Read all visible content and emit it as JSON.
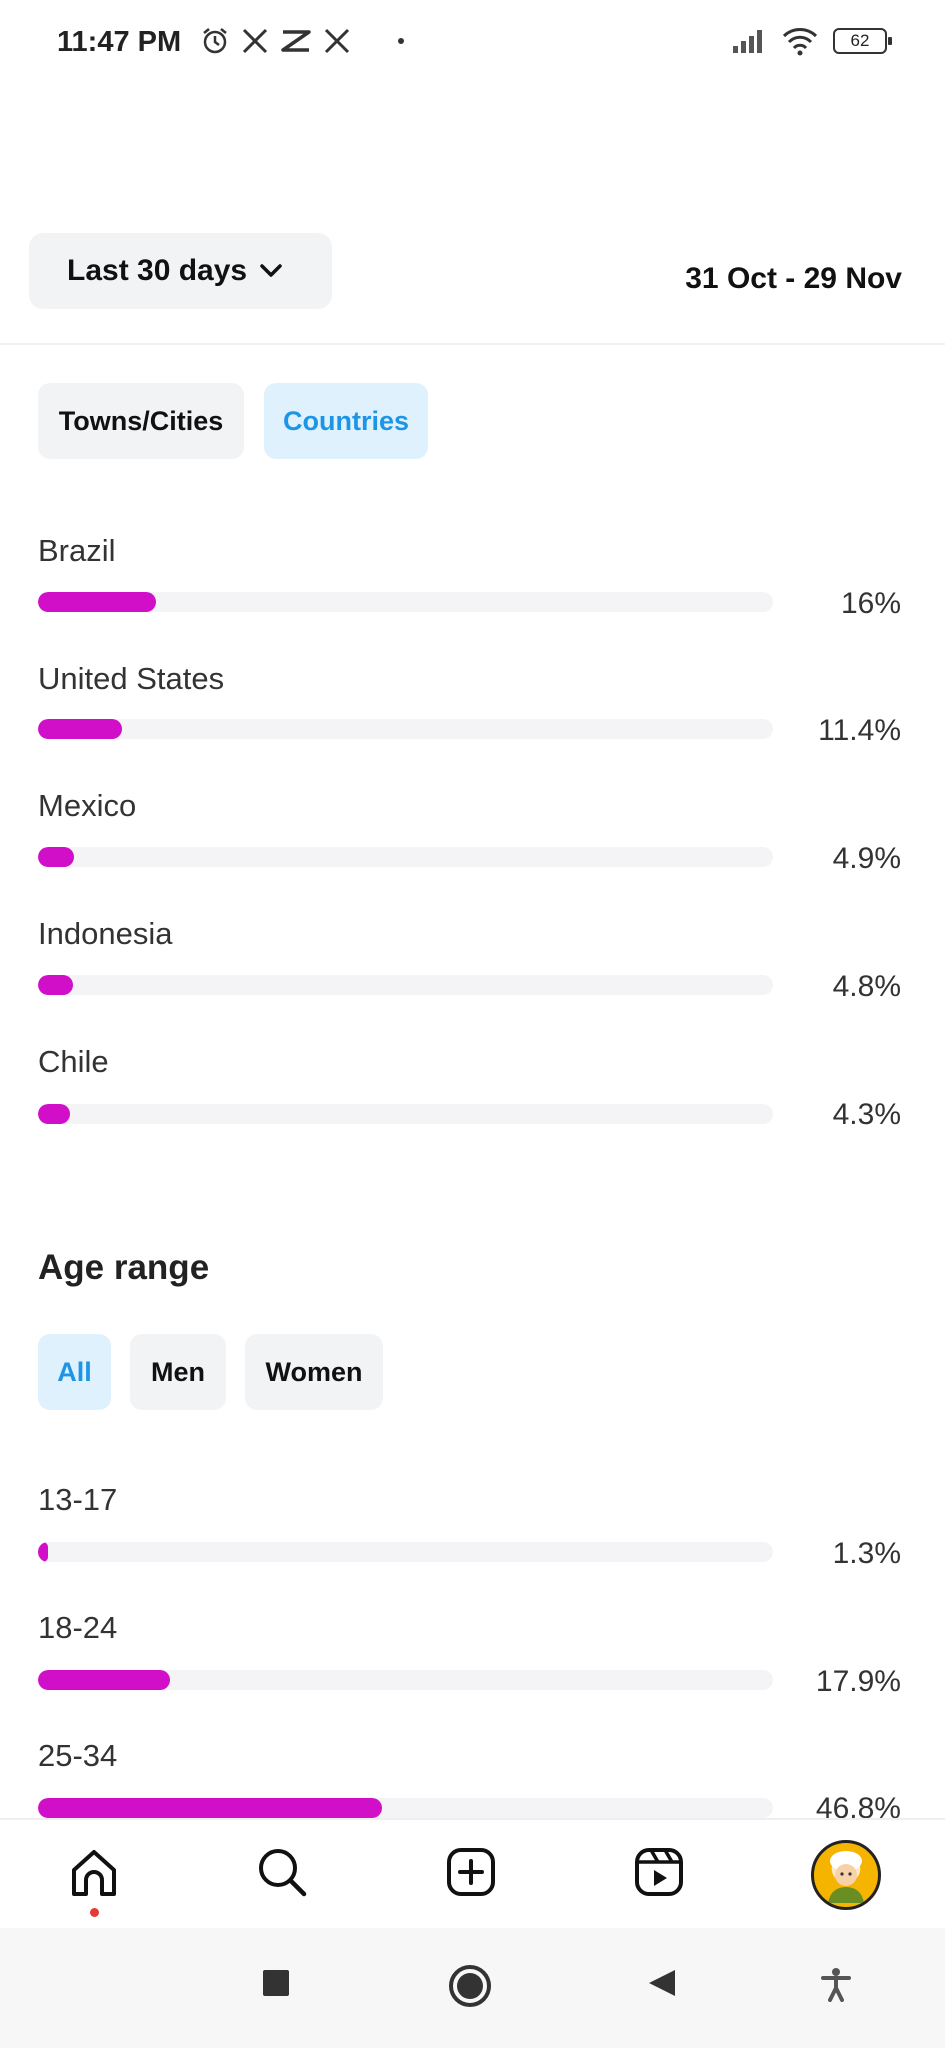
{
  "status_bar": {
    "time": "11:47 PM",
    "left_icons": [
      "alarm-icon",
      "x-icon",
      "capcut-icon",
      "x-icon",
      "dot"
    ],
    "battery": "62"
  },
  "header": {
    "range_label": "Last 30 days",
    "date_range": "31 Oct - 29 Nov"
  },
  "location": {
    "tabs": [
      {
        "label": "Towns/Cities",
        "active": false
      },
      {
        "label": "Countries",
        "active": true
      }
    ],
    "rows": [
      {
        "label": "Brazil",
        "pct_text": "16%",
        "value": 16
      },
      {
        "label": "United States",
        "pct_text": "11.4%",
        "value": 11.4
      },
      {
        "label": "Mexico",
        "pct_text": "4.9%",
        "value": 4.9
      },
      {
        "label": "Indonesia",
        "pct_text": "4.8%",
        "value": 4.8
      },
      {
        "label": "Chile",
        "pct_text": "4.3%",
        "value": 4.3
      }
    ]
  },
  "age": {
    "title": "Age range",
    "tabs": [
      {
        "label": "All",
        "active": true
      },
      {
        "label": "Men",
        "active": false
      },
      {
        "label": "Women",
        "active": false
      }
    ],
    "rows": [
      {
        "label": "13-17",
        "pct_text": "1.3%",
        "value": 1.3
      },
      {
        "label": "18-24",
        "pct_text": "17.9%",
        "value": 17.9
      },
      {
        "label": "25-34",
        "pct_text": "46.8%",
        "value": 46.8
      }
    ]
  },
  "bottom_nav": {
    "items": [
      "home-icon",
      "search-icon",
      "create-icon",
      "reels-icon",
      "profile-avatar"
    ]
  },
  "colors": {
    "bar_fill": "#d10ec8",
    "track": "#f4f4f6",
    "active_chip_bg": "#e0f1fe",
    "active_chip_text": "#1d95e6"
  }
}
